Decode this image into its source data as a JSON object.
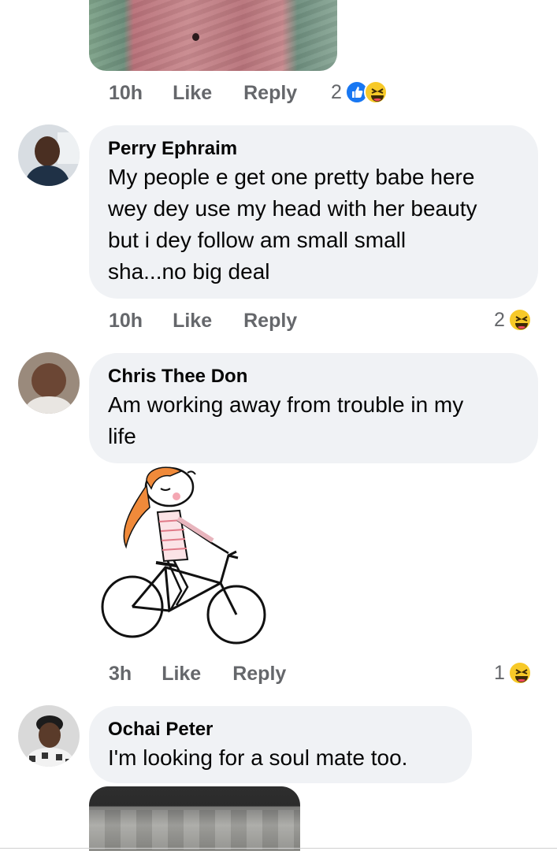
{
  "comments": [
    {
      "time": "10h",
      "like_label": "Like",
      "reply_label": "Reply",
      "reaction_count": "2",
      "reactions": [
        "like-icon",
        "haha-icon"
      ]
    },
    {
      "author": "Perry Ephraim",
      "lines": [
        "My people e get one pretty babe here",
        "wey dey use my head with her beauty",
        "but i dey follow am small small",
        "sha...no big deal"
      ],
      "time": "10h",
      "like_label": "Like",
      "reply_label": "Reply",
      "reaction_count": "2",
      "reactions": [
        "haha-icon"
      ]
    },
    {
      "author": "Chris Thee Don",
      "lines": [
        "Am working away from trouble in my",
        "life"
      ],
      "sticker": "girl-on-bicycle-sticker",
      "time": "3h",
      "like_label": "Like",
      "reply_label": "Reply",
      "reaction_count": "1",
      "reactions": [
        "haha-icon"
      ]
    },
    {
      "author": "Ochai Peter",
      "lines": [
        "I'm looking for a soul mate too."
      ]
    }
  ],
  "colors": {
    "bubble": "#f0f2f5",
    "meta_text": "#65676b",
    "like_blue": "#1877f2",
    "haha_yellow": "#f7c928"
  }
}
